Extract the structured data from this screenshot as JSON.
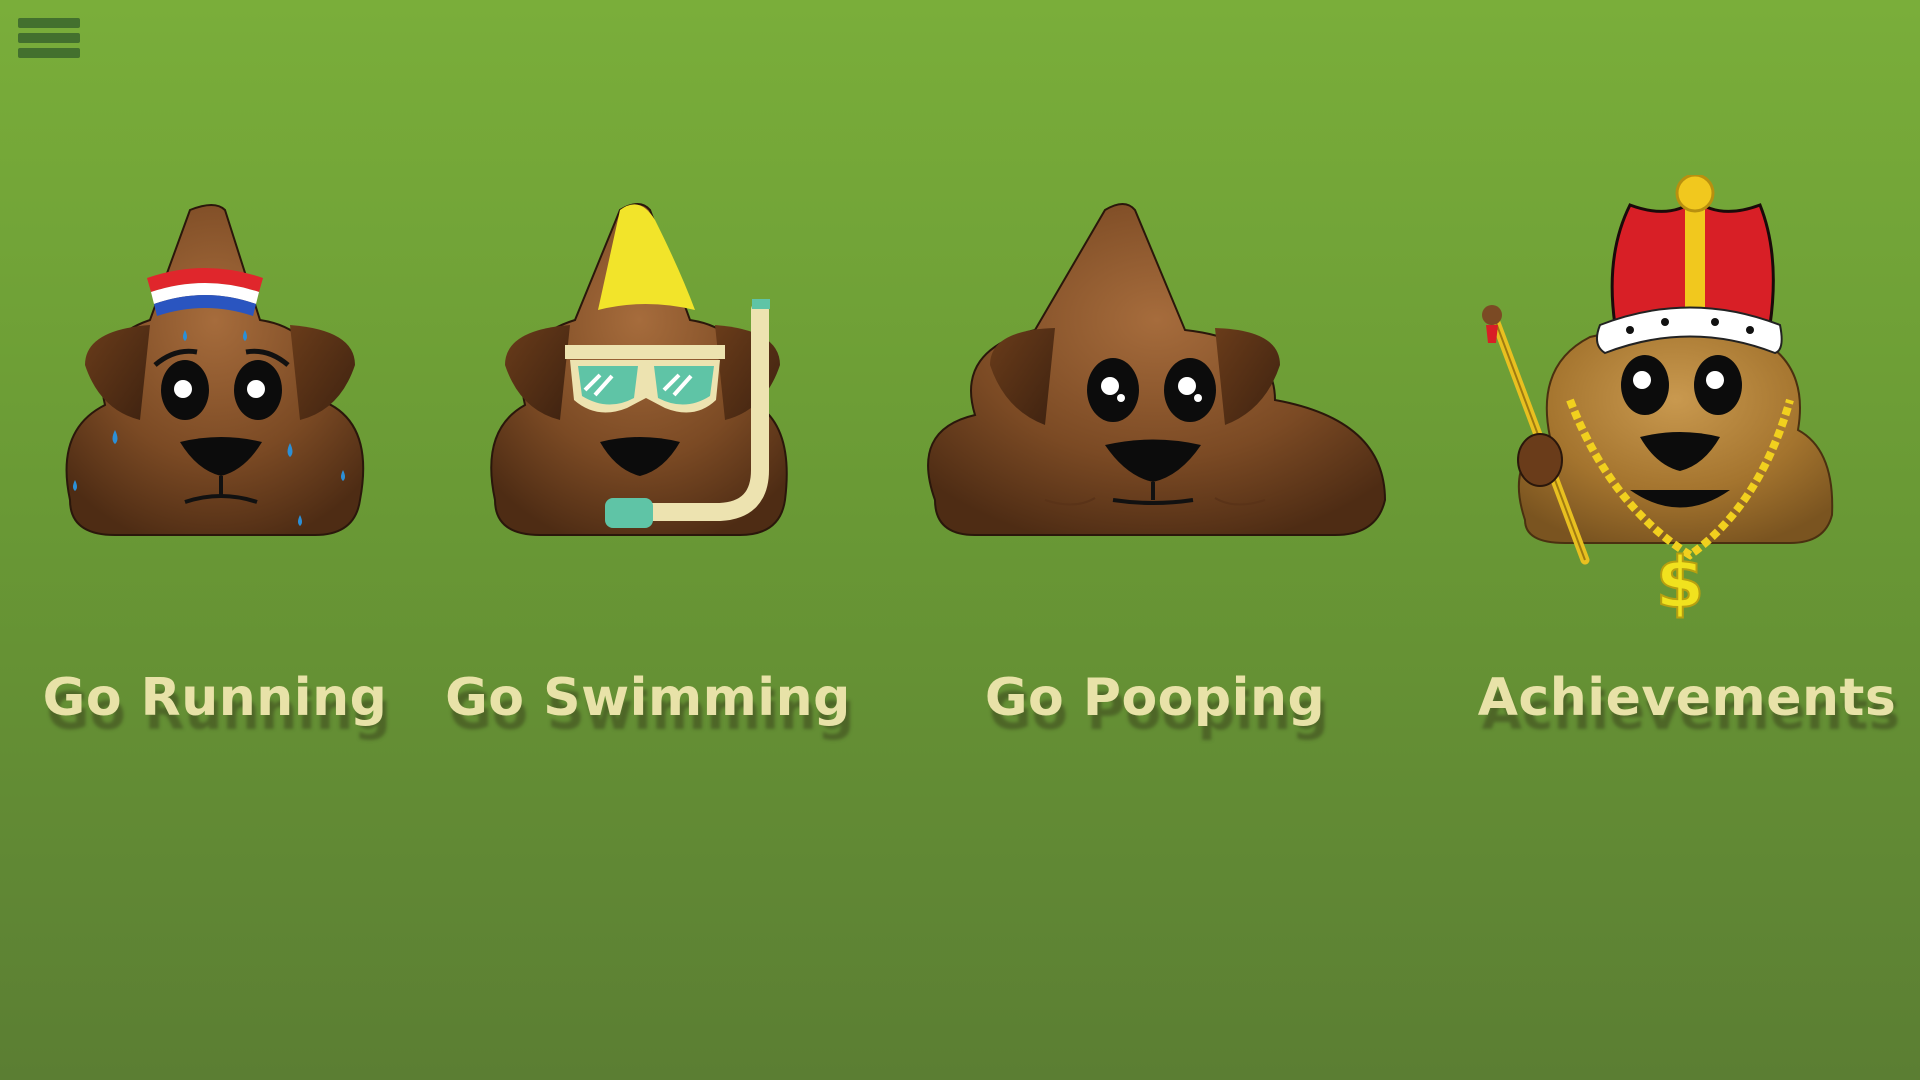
{
  "menu": {
    "icon": "hamburger-menu-icon"
  },
  "tiles": [
    {
      "label": "Go Running",
      "icon": "poop-runner-headband-icon"
    },
    {
      "label": "Go Swimming",
      "icon": "poop-swimmer-snorkel-icon"
    },
    {
      "label": "Go Pooping",
      "icon": "poop-dog-icon"
    },
    {
      "label": "Achievements",
      "icon": "poop-king-crown-icon"
    }
  ],
  "colors": {
    "background_top": "#7aae3a",
    "background_bottom": "#5b7e33",
    "label_text": "#e8e2a8",
    "menu_bars": "#43702e"
  }
}
